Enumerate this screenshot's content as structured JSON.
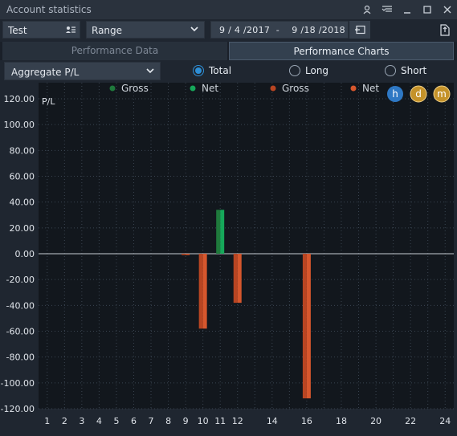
{
  "window": {
    "title": "Account statistics"
  },
  "toolbar": {
    "account": "Test",
    "range": "Range",
    "date_from": "9 / 4 /2017",
    "date_sep": "-",
    "date_to": "9 /18 /2018"
  },
  "tabs": [
    {
      "label": "Performance Data",
      "active": false
    },
    {
      "label": "Performance Charts",
      "active": true
    }
  ],
  "options": {
    "aggregate": "Aggregate P/L",
    "radios": [
      {
        "label": "Total",
        "selected": true
      },
      {
        "label": "Long",
        "selected": false
      },
      {
        "label": "Short",
        "selected": false
      }
    ]
  },
  "chart_data": {
    "type": "bar",
    "ylabel": "P/L",
    "ylim": [
      -120,
      120
    ],
    "yticks": [
      "120.00",
      "100.00",
      "80.00",
      "60.00",
      "40.00",
      "20.00",
      "0.00",
      "-20.00",
      "-40.00",
      "-60.00",
      "-80.00",
      "-100.00",
      "-120.00"
    ],
    "xticks": [
      1,
      2,
      3,
      4,
      5,
      6,
      7,
      8,
      9,
      10,
      11,
      12,
      14,
      16,
      18,
      20,
      22,
      24
    ],
    "grid": true,
    "legend": [
      {
        "name": "Gross",
        "color": "#1f7a3c"
      },
      {
        "name": "Net",
        "color": "#16a85a"
      },
      {
        "name": "Gross",
        "color": "#b84522"
      },
      {
        "name": "Net",
        "color": "#d6572d"
      }
    ],
    "series": [
      {
        "name": "Gross",
        "color": "#1f7a3c",
        "points": [
          {
            "x": 11,
            "y": 34
          }
        ]
      },
      {
        "name": "Net",
        "color": "#16a85a",
        "points": [
          {
            "x": 11,
            "y": 34
          }
        ]
      },
      {
        "name": "Gross",
        "color": "#b84522",
        "points": [
          {
            "x": 9,
            "y": -1
          },
          {
            "x": 10,
            "y": -58
          },
          {
            "x": 12,
            "y": -38
          },
          {
            "x": 16,
            "y": -112
          }
        ]
      },
      {
        "name": "Net",
        "color": "#d6572d",
        "points": [
          {
            "x": 9,
            "y": -1
          },
          {
            "x": 10,
            "y": -58
          },
          {
            "x": 12,
            "y": -38
          },
          {
            "x": 16,
            "y": -112
          }
        ]
      }
    ],
    "scale_buttons": [
      "h",
      "d",
      "m"
    ],
    "colors": {
      "background": "#12171d",
      "grid": "#3a4450",
      "zero_line": "#c7ccd3",
      "axis_text": "#e0e4ea",
      "scale_active": "#2e78c4",
      "scale_inactive": "#c4922a"
    }
  }
}
